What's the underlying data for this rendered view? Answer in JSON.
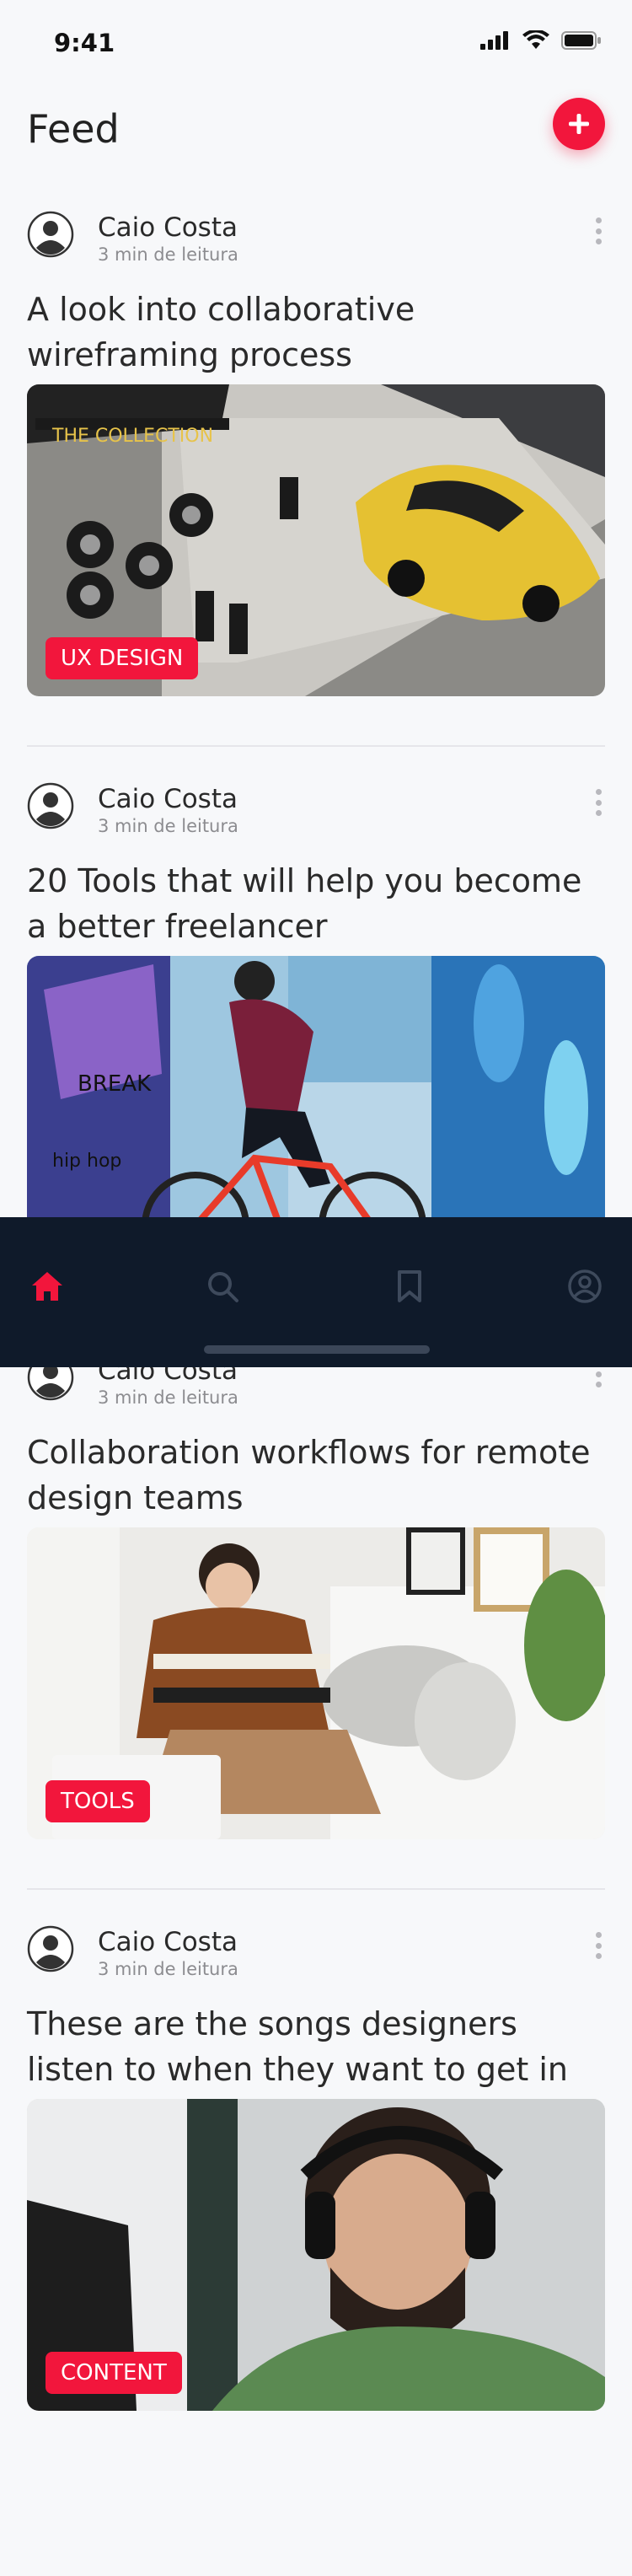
{
  "status_bar": {
    "time": "9:41"
  },
  "header": {
    "title": "Feed",
    "add_icon": "plus-icon"
  },
  "colors": {
    "accent": "#f2163c",
    "nav_bg": "#0f1a2a",
    "background": "#f7f8fa"
  },
  "posts": [
    {
      "author": "Caio Costa",
      "read_time": "3 min de leitura",
      "title": "A look into collaborative wireframing process",
      "tag": "UX DESIGN"
    },
    {
      "author": "Caio Costa",
      "read_time": "3 min de leitura",
      "title": "20 Tools that will help you become a better freelancer",
      "tag": ""
    },
    {
      "author": "Caio Costa",
      "read_time": "3 min de leitura",
      "title": "Collaboration workflows for remote design teams",
      "tag": "TOOLS"
    },
    {
      "author": "Caio Costa",
      "read_time": "3 min de leitura",
      "title": "These are the songs designers listen to when they want to get in the zone",
      "tag": "CONTENT"
    }
  ],
  "bottom_nav": {
    "items": [
      {
        "icon": "home-icon",
        "active": true
      },
      {
        "icon": "search-icon",
        "active": false
      },
      {
        "icon": "bookmark-icon",
        "active": false
      },
      {
        "icon": "profile-icon",
        "active": false
      }
    ]
  }
}
